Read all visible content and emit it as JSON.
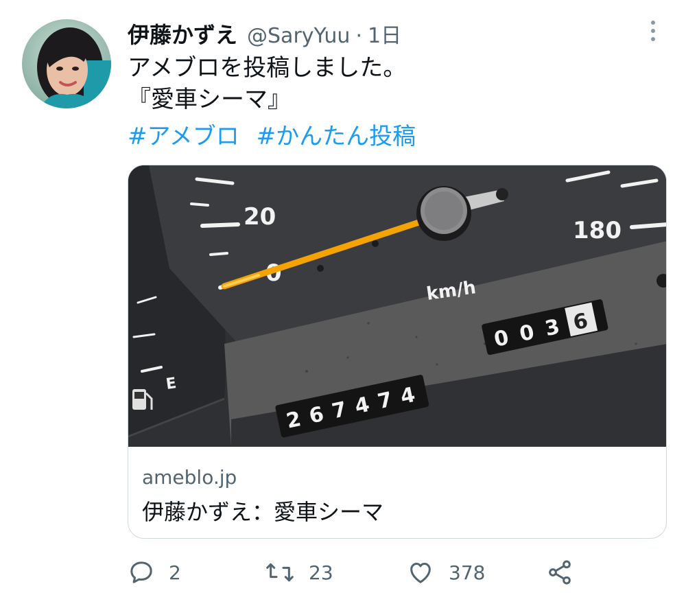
{
  "tweet": {
    "author": {
      "display_name": "伊藤かずえ",
      "handle": "@SaryYuu"
    },
    "separator": "·",
    "timestamp": "1日",
    "text_lines": [
      "アメブロを投稿しました。",
      "『愛車シーマ』"
    ],
    "hashtags": [
      "#アメブロ",
      "#かんたん投稿"
    ],
    "card": {
      "image": {
        "subject": "speedometer-photo",
        "dial_labels": [
          "20",
          "0",
          "180",
          "E"
        ],
        "unit_label": "km/h",
        "odometer": [
          "2",
          "6",
          "7",
          "4",
          "7",
          "4"
        ],
        "trip_meter": [
          "0",
          "0",
          "3",
          "6"
        ]
      },
      "domain": "ameblo.jp",
      "title": "伊藤かずえ：愛車シーマ"
    },
    "actions": {
      "reply_count": "2",
      "retweet_count": "23",
      "like_count": "378"
    }
  },
  "colors": {
    "accent": "#1d9bf0",
    "secondary_text": "#536471",
    "primary_text": "#0f1419",
    "border": "#cfd9de",
    "needle": "#f5a300"
  }
}
